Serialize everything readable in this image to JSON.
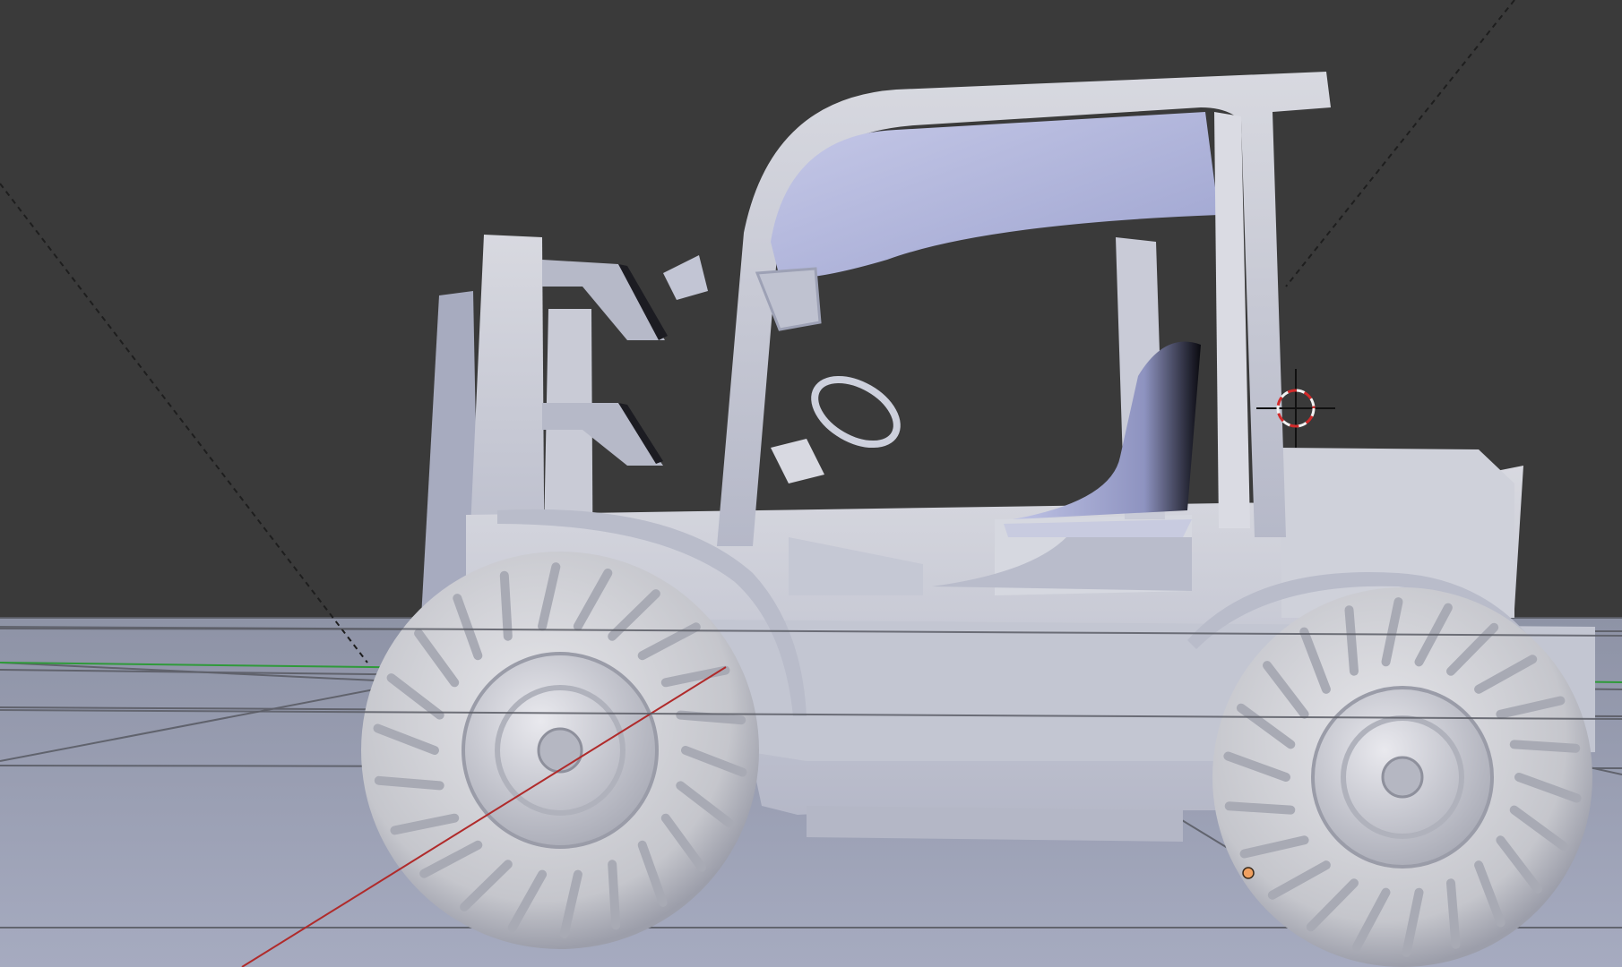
{
  "app": {
    "name": "",
    "view": "3d-viewport"
  },
  "colors": {
    "background": "#3a3a3a",
    "ground_top": "#8e93a6",
    "ground_bottom": "#a6abc0",
    "model_light": "#d2d3da",
    "model_mid": "#b8bac6",
    "model_shadow": "#8f92a7",
    "model_blue_tint": "#aeb3d8",
    "axis_x": "#b02b2b",
    "axis_y": "#2f9a3a",
    "grid_line": "#5b5d66",
    "camera_guide": "#1e1e1e",
    "cursor_red": "#d22a2a",
    "cursor_white": "#f2f2f2",
    "origin_dot": "#f0a060"
  },
  "scene": {
    "object": "forklift",
    "shading": "solid",
    "visible_elements": [
      "3d-cursor-icon",
      "object-origin-dot",
      "x-axis-line",
      "y-axis-line",
      "floor-grid",
      "camera-guide-lines"
    ]
  }
}
